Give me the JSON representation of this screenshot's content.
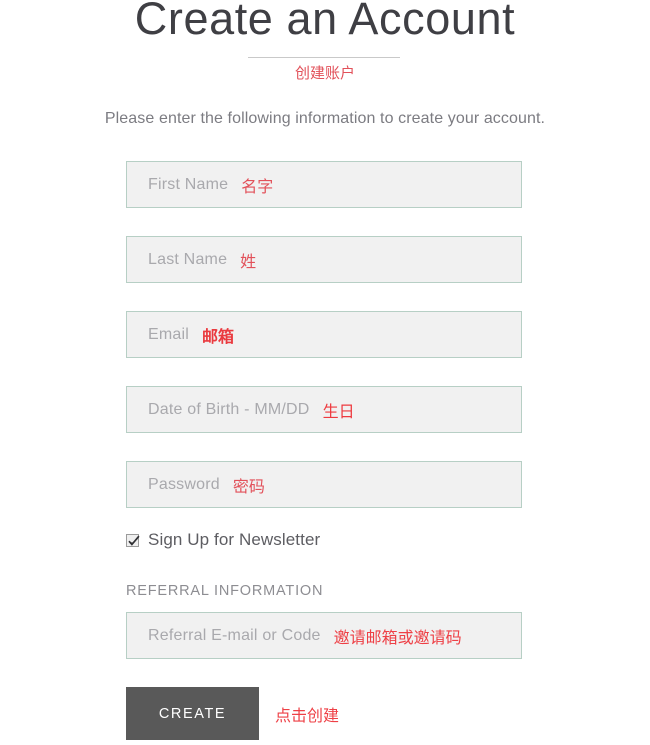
{
  "header": {
    "title": "Create an Account",
    "title_cn": "创建账户",
    "subtitle": "Please enter the following information to create your account."
  },
  "form": {
    "fields": [
      {
        "name": "first-name",
        "placeholder": "First Name",
        "annotation_cn": "名字",
        "value": ""
      },
      {
        "name": "last-name",
        "placeholder": "Last Name",
        "annotation_cn": "姓",
        "value": ""
      },
      {
        "name": "email",
        "placeholder": "Email",
        "annotation_cn": "邮箱",
        "value": ""
      },
      {
        "name": "date-of-birth",
        "placeholder": "Date of Birth - MM/DD",
        "annotation_cn": "生日",
        "value": ""
      },
      {
        "name": "password",
        "placeholder": "Password",
        "annotation_cn": "密码",
        "value": ""
      }
    ]
  },
  "newsletter": {
    "label": "Sign Up for Newsletter",
    "checked": true
  },
  "referral": {
    "section_heading": "REFERRAL INFORMATION",
    "placeholder": "Referral E-mail or Code",
    "annotation_cn": "邀请邮箱或邀请码",
    "value": ""
  },
  "submit": {
    "label": "CREATE",
    "annotation_cn": "点击创建"
  },
  "colors": {
    "page_background": "#ffffff",
    "title_text": "#3f3f44",
    "annotation_red": "#e2515a",
    "field_border": "#b7cfc5",
    "field_background": "#f1f1f1",
    "placeholder_text": "#a9a9ad",
    "button_background": "#595959",
    "button_text": "#ffffff",
    "divider": "#c9c9c9"
  }
}
